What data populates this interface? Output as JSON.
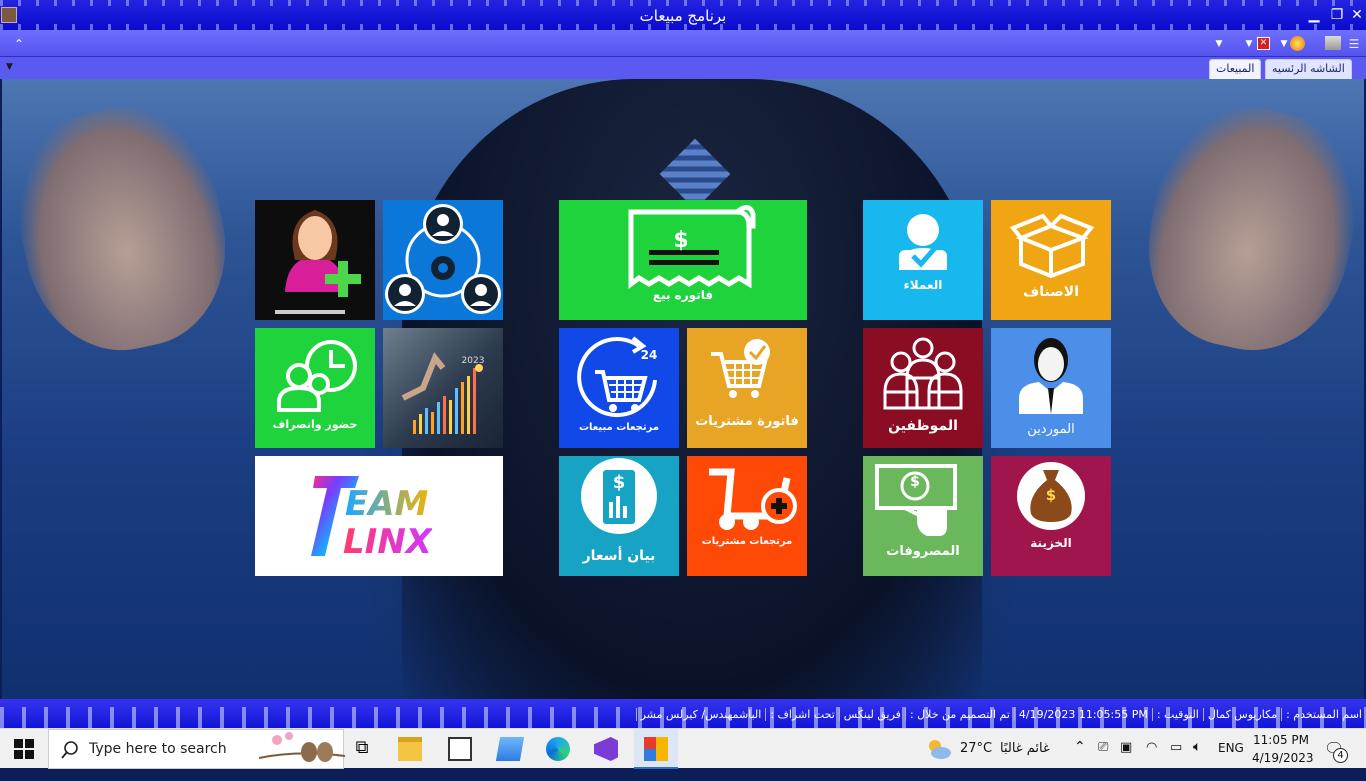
{
  "window": {
    "title": "برنامج مبيعات"
  },
  "tabs": [
    {
      "label": "الشاشه الرئسيه",
      "active": false
    },
    {
      "label": "المبيعات",
      "active": true
    }
  ],
  "tiles": {
    "categories": "الاصناف",
    "customers": "العملاء",
    "sales_invoice": "فاتوره بيع",
    "suppliers": "الموردين",
    "employees": "الموظفين",
    "purchase_invoice": "فاتورة مشتريات",
    "sales_returns": "مرتجعات مبيعات",
    "sales_returns_badge": "24",
    "attendance": "حضور وانصراف",
    "treasury": "الخزينة",
    "expenses": "المصروفات",
    "purchase_returns": "مرتجعات مشتريات",
    "price_quote": "بيان أسعار",
    "chart_year": "2023",
    "team_logo": "TEAM LINX",
    "dollar_sign": "$"
  },
  "status_bar": {
    "user_label": "اسم المستخدم :",
    "user_value": "مكاريوس كمال",
    "time_label": "التوقيت :",
    "time_value": "4/19/2023 11:05:55 PM",
    "design_label": "تم التصميم من خلال :",
    "design_value": "فريق لينكس",
    "supervision_label": "تحت اشراف :",
    "supervision_value": "الباشمهندس/ كيرلس مشر"
  },
  "taskbar": {
    "search_placeholder": "Type here to search",
    "weather_temp": "27°C",
    "weather_text": "غائم غالبًا",
    "language": "ENG",
    "time": "11:05 PM",
    "date": "4/19/2023",
    "notification_count": "4"
  },
  "colors": {
    "title_bar": "#1414d6",
    "green": "#1fd33c",
    "blue": "#0b77d9",
    "orange": "#f0a513",
    "cyan": "#18b8ef",
    "maroon": "#8a0d24",
    "sky": "#4b8fe8",
    "royal": "#1149e8",
    "gold": "#e8a424",
    "teal": "#17a3c4",
    "red_orange": "#fe4a06",
    "olive_green": "#6bb85c",
    "berry": "#a1154d"
  }
}
